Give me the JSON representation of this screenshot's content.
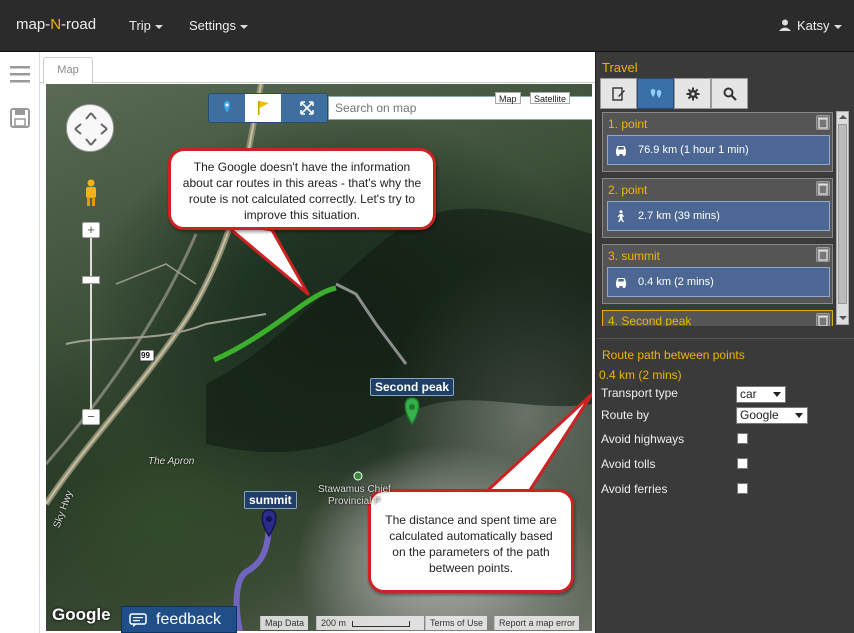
{
  "app": {
    "brand_prefix": "map-",
    "brand_n": "N",
    "brand_suffix": "-road",
    "menu": [
      {
        "label": "Trip"
      },
      {
        "label": "Settings"
      }
    ],
    "user": "Katsy"
  },
  "map_tab": {
    "label": "Map"
  },
  "map": {
    "search_placeholder": "Search on map",
    "maptype_labels": [
      "Map",
      "Satellite"
    ],
    "zoom_in": "+",
    "zoom_out": "−",
    "labels": {
      "second_peak": "Second peak",
      "summit": "summit",
      "the_apron": "The Apron",
      "park": "Stawamus Chief\nProvincial P",
      "sky_hwy": "Sky Hwy",
      "hwy_badge": "99"
    },
    "google": "Google",
    "footer": {
      "map_data": "Map Data",
      "scale": "200 m",
      "terms": "Terms of Use",
      "report": "Report a map error"
    },
    "callout_top": "The Google doesn't have the information about car routes in this areas - that's why the route is not calculated correctly. Let's try to improve this situation.",
    "callout_bottom": "The distance and spent time are calculated automatically based on the parameters of the path between points.",
    "route_colors": {
      "green": "#3cb02d",
      "purple": "#7a6ad8"
    }
  },
  "feedback": {
    "label": "feedback"
  },
  "panel": {
    "title": "Travel",
    "tabs": [
      "edit-icon",
      "route-icon",
      "gear-icon",
      "search-icon"
    ],
    "points": [
      {
        "title": "1. point",
        "transport": "car",
        "route": "76.9 km (1 hour 1 min)"
      },
      {
        "title": "2. point",
        "transport": "walk",
        "route": "2.7 km (39 mins)"
      },
      {
        "title": "3. summit",
        "transport": "car",
        "route": "0.4 km (2 mins)"
      },
      {
        "title": "4. Second peak"
      }
    ],
    "route_section": {
      "title": "Route path between points",
      "distance": "0.4 km (2 mins)",
      "transport_label": "Transport type",
      "transport_value": "car",
      "route_by_label": "Route by",
      "route_by_value": "Google",
      "avoid_highways": "Avoid highways",
      "avoid_tolls": "Avoid tolls",
      "avoid_ferries": "Avoid ferries"
    },
    "accent": "#f0b400"
  }
}
